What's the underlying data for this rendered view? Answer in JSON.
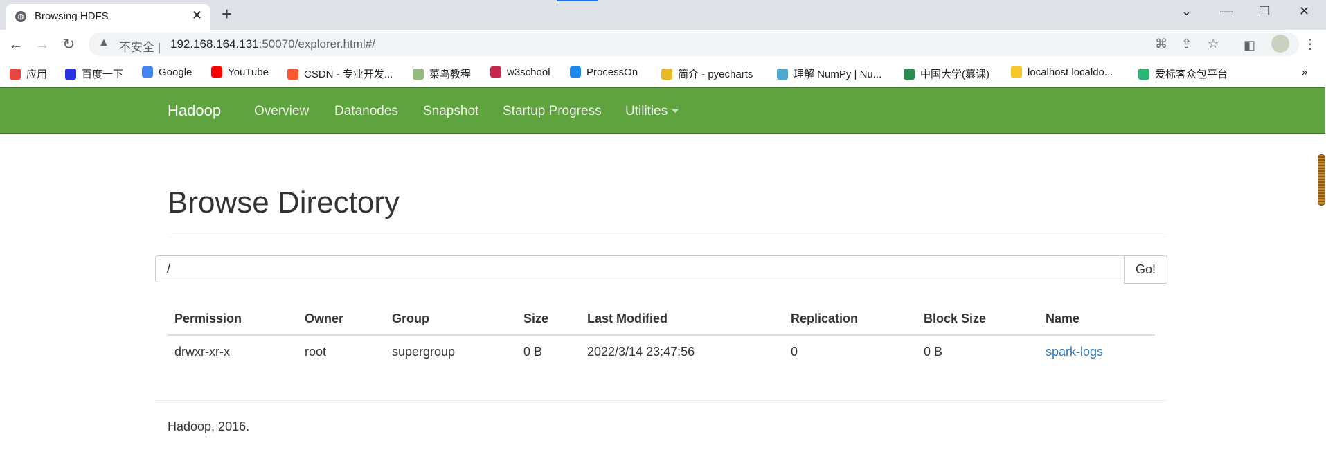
{
  "browser": {
    "tab_title": "Browsing HDFS",
    "new_tab": "+",
    "omnibox": {
      "insecure_label": "不安全 |",
      "host": "192.168.164.131",
      "path": ":50070/explorer.html#/"
    },
    "bookmarks": [
      {
        "label": "应用",
        "icon": "apps-grid-icon",
        "color": "#e8453c"
      },
      {
        "label": "百度一下",
        "icon": "baidu-paw-icon",
        "color": "#2932e1"
      },
      {
        "label": "Google",
        "icon": "google-g-icon",
        "color": "#4285f4"
      },
      {
        "label": "YouTube",
        "icon": "youtube-play-icon",
        "color": "#ff0000"
      },
      {
        "label": "CSDN - 专业开发...",
        "icon": "csdn-c-icon",
        "color": "#fc5531"
      },
      {
        "label": "菜鸟教程",
        "icon": "runoob-icon",
        "color": "#96b97d"
      },
      {
        "label": "w3school",
        "icon": "w3school-icon",
        "color": "#c7254e"
      },
      {
        "label": "ProcessOn",
        "icon": "processon-icon",
        "color": "#1d87f0"
      },
      {
        "label": "简介 - pyecharts",
        "icon": "pyecharts-icon",
        "color": "#e8b923"
      },
      {
        "label": "理解 NumPy | Nu...",
        "icon": "numpy-icon",
        "color": "#4dabcf"
      },
      {
        "label": "中国大学(慕课)",
        "icon": "mooc-book-icon",
        "color": "#2a8d4f"
      },
      {
        "label": "localhost.localdo...",
        "icon": "python-icon",
        "color": "#f6c928"
      },
      {
        "label": "爱标客众包平台",
        "icon": "aibiaoke-icon",
        "color": "#2bb673"
      }
    ],
    "bookmarks_overflow": "»"
  },
  "navbar": {
    "brand": "Hadoop",
    "links": [
      "Overview",
      "Datanodes",
      "Snapshot",
      "Startup Progress",
      "Utilities"
    ]
  },
  "main": {
    "title": "Browse Directory",
    "path_value": "/",
    "go_label": "Go!",
    "table": {
      "headers": [
        "Permission",
        "Owner",
        "Group",
        "Size",
        "Last Modified",
        "Replication",
        "Block Size",
        "Name"
      ],
      "rows": [
        [
          "drwxr-xr-x",
          "root",
          "supergroup",
          "0 B",
          "2022/3/14 23:47:56",
          "0",
          "0 B",
          "spark-logs"
        ]
      ]
    },
    "footer": "Hadoop, 2016."
  }
}
